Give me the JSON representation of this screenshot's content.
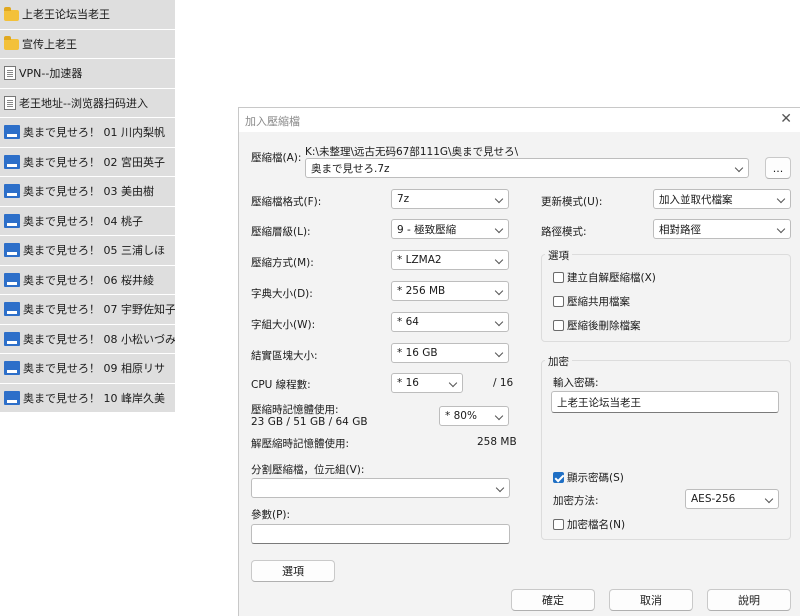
{
  "file_list": [
    {
      "icon": "folder-icon",
      "label": "上老王论坛当老王"
    },
    {
      "icon": "folder-icon",
      "label": "宣传上老王"
    },
    {
      "icon": "document-icon",
      "label": "VPN--加速器"
    },
    {
      "icon": "document-icon",
      "label": "老王地址--浏览器扫码进入"
    },
    {
      "icon": "archive-icon",
      "label": "奥まで見せろ！ 01 川内梨帆"
    },
    {
      "icon": "archive-icon",
      "label": "奥まで見せろ！ 02 宮田英子"
    },
    {
      "icon": "archive-icon",
      "label": "奥まで見せろ！ 03 美由樹"
    },
    {
      "icon": "archive-icon",
      "label": "奥まで見せろ！ 04 桃子"
    },
    {
      "icon": "archive-icon",
      "label": "奥まで見せろ！ 05 三浦しほ"
    },
    {
      "icon": "archive-icon",
      "label": "奥まで見せろ！ 06 桜井綾"
    },
    {
      "icon": "archive-icon",
      "label": "奥まで見せろ！ 07 宇野佐知子"
    },
    {
      "icon": "archive-icon",
      "label": "奥まで見せろ！ 08 小松いづみ"
    },
    {
      "icon": "archive-icon",
      "label": "奥まで見せろ！ 09 相原リサ"
    },
    {
      "icon": "archive-icon",
      "label": "奥まで見せろ！ 10 峰岸久美"
    }
  ],
  "dialog": {
    "title": "加入壓縮檔",
    "archive_label": "壓縮檔(A):",
    "archive_path": "K:\\未整理\\远古无码67部111G\\奥まで見せろ\\",
    "archive_name": "奥まで見せろ.7z",
    "browse_label": "...",
    "format_label": "壓縮檔格式(F):",
    "format_value": "7z",
    "level_label": "壓縮層級(L):",
    "level_value": "9 - 極致壓縮",
    "method_label": "壓縮方式(M):",
    "method_value": "* LZMA2",
    "dict_label": "字典大小(D):",
    "dict_value": "* 256 MB",
    "word_label": "字組大小(W):",
    "word_value": "* 64",
    "solid_label": "結實區塊大小:",
    "solid_value": "* 16 GB",
    "cpu_label": "CPU 線程數:",
    "cpu_value": "* 16",
    "cpu_total": "/ 16",
    "mem_label": "壓縮時記憶體使用:",
    "mem_detail": "23 GB / 51 GB / 64 GB",
    "mem_value": "* 80%",
    "decomp_label": "解壓縮時記憶體使用:",
    "decomp_value": "258 MB",
    "split_label": "分割壓縮檔，位元組(V):",
    "split_value": "",
    "params_label": "參數(P):",
    "params_value": "",
    "options_button": "選項",
    "update_label": "更新模式(U):",
    "update_value": "加入並取代檔案",
    "path_label": "路徑模式:",
    "path_value": "相對路徑",
    "options_group": "選項",
    "opt_sfx": "建立自解壓縮檔(X)",
    "opt_shared": "壓縮共用檔案",
    "opt_delete": "壓縮後刪除檔案",
    "encrypt_group": "加密",
    "password_label": "輸入密碼:",
    "password_value": "上老王论坛当老王",
    "show_password": "顯示密碼(S)",
    "enc_method_label": "加密方法:",
    "enc_method_value": "AES-256",
    "encrypt_names": "加密檔名(N)",
    "ok": "確定",
    "cancel": "取消",
    "help": "說明",
    "close_glyph": "✕"
  }
}
